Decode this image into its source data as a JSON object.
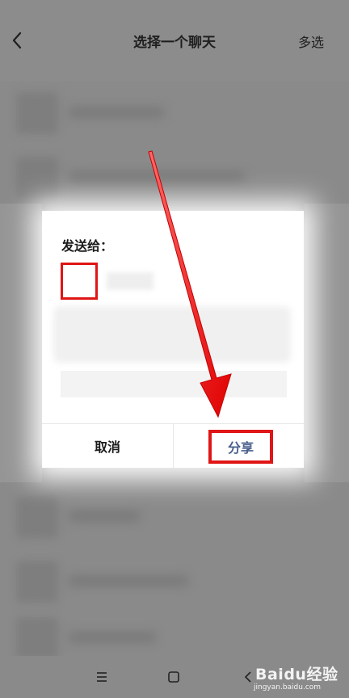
{
  "header": {
    "title": "选择一个聊天",
    "multi_select_label": "多选",
    "back_icon": "chevron-left-icon"
  },
  "dialog": {
    "title": "发送给：",
    "message_placeholder": "",
    "cancel_label": "取消",
    "share_label": "分享"
  },
  "annotation": {
    "highlight_color": "#e01515",
    "arrow_icon": "red-arrow-icon"
  },
  "navbar": {
    "menu_icon": "menu-icon",
    "home_icon": "home-square-icon",
    "back_icon": "back-triangle-icon"
  },
  "watermark": {
    "brand": "Baidu经验",
    "url": "jingyan.baidu.com"
  }
}
